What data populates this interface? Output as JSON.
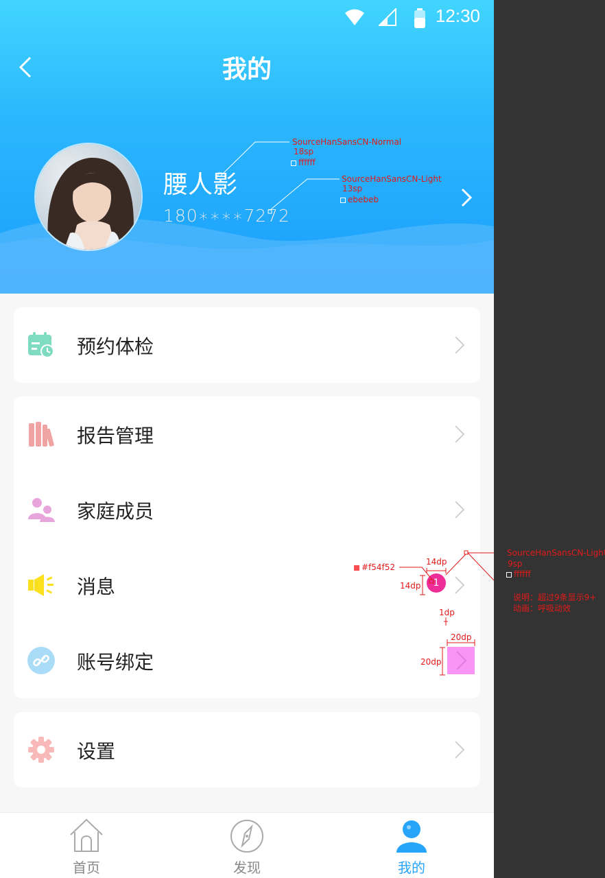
{
  "status_bar": {
    "time": "12:30"
  },
  "header": {
    "title": "我的"
  },
  "profile": {
    "name": "腰人影",
    "phone": "180∗∗∗∗7272"
  },
  "menu": [
    {
      "label": "预约体检",
      "icon": "calendar-clock-icon",
      "color": "#7fdcc0"
    },
    {
      "label": "报告管理",
      "icon": "books-icon",
      "color": "#f0a3a3"
    },
    {
      "label": "家庭成员",
      "icon": "family-members-icon",
      "color": "#e8a5dc"
    },
    {
      "label": "消息",
      "icon": "megaphone-icon",
      "color": "#fde01d",
      "badge": "1"
    },
    {
      "label": "账号绑定",
      "icon": "link-icon",
      "color": "#8fd0f5"
    },
    {
      "label": "设置",
      "icon": "gear-icon",
      "color": "#f9b9b9"
    }
  ],
  "tabs": [
    {
      "label": "首页",
      "icon": "home-icon",
      "active": false
    },
    {
      "label": "发现",
      "icon": "compass-icon",
      "active": false
    },
    {
      "label": "我的",
      "icon": "user-icon",
      "active": true
    }
  ],
  "annotations": {
    "name_font": "SourceHanSansCN-Normal",
    "name_size": "18sp",
    "name_color": "ffffff",
    "phone_font": "SourceHanSansCN-Light",
    "phone_size": "13sp",
    "phone_color": "ebebeb",
    "badge_color": "#f54f52",
    "badge_w": "14dp",
    "badge_h": "14dp",
    "badge_font": "SourceHanSansCN-Light",
    "badge_font_size": "9sp",
    "badge_font_color": "ffffff",
    "badge_note": "说明：超过9条显示9+",
    "badge_anim": "动画：呼吸动效",
    "gap": "1dp",
    "arrow_w": "20dp",
    "arrow_h": "20dp"
  }
}
